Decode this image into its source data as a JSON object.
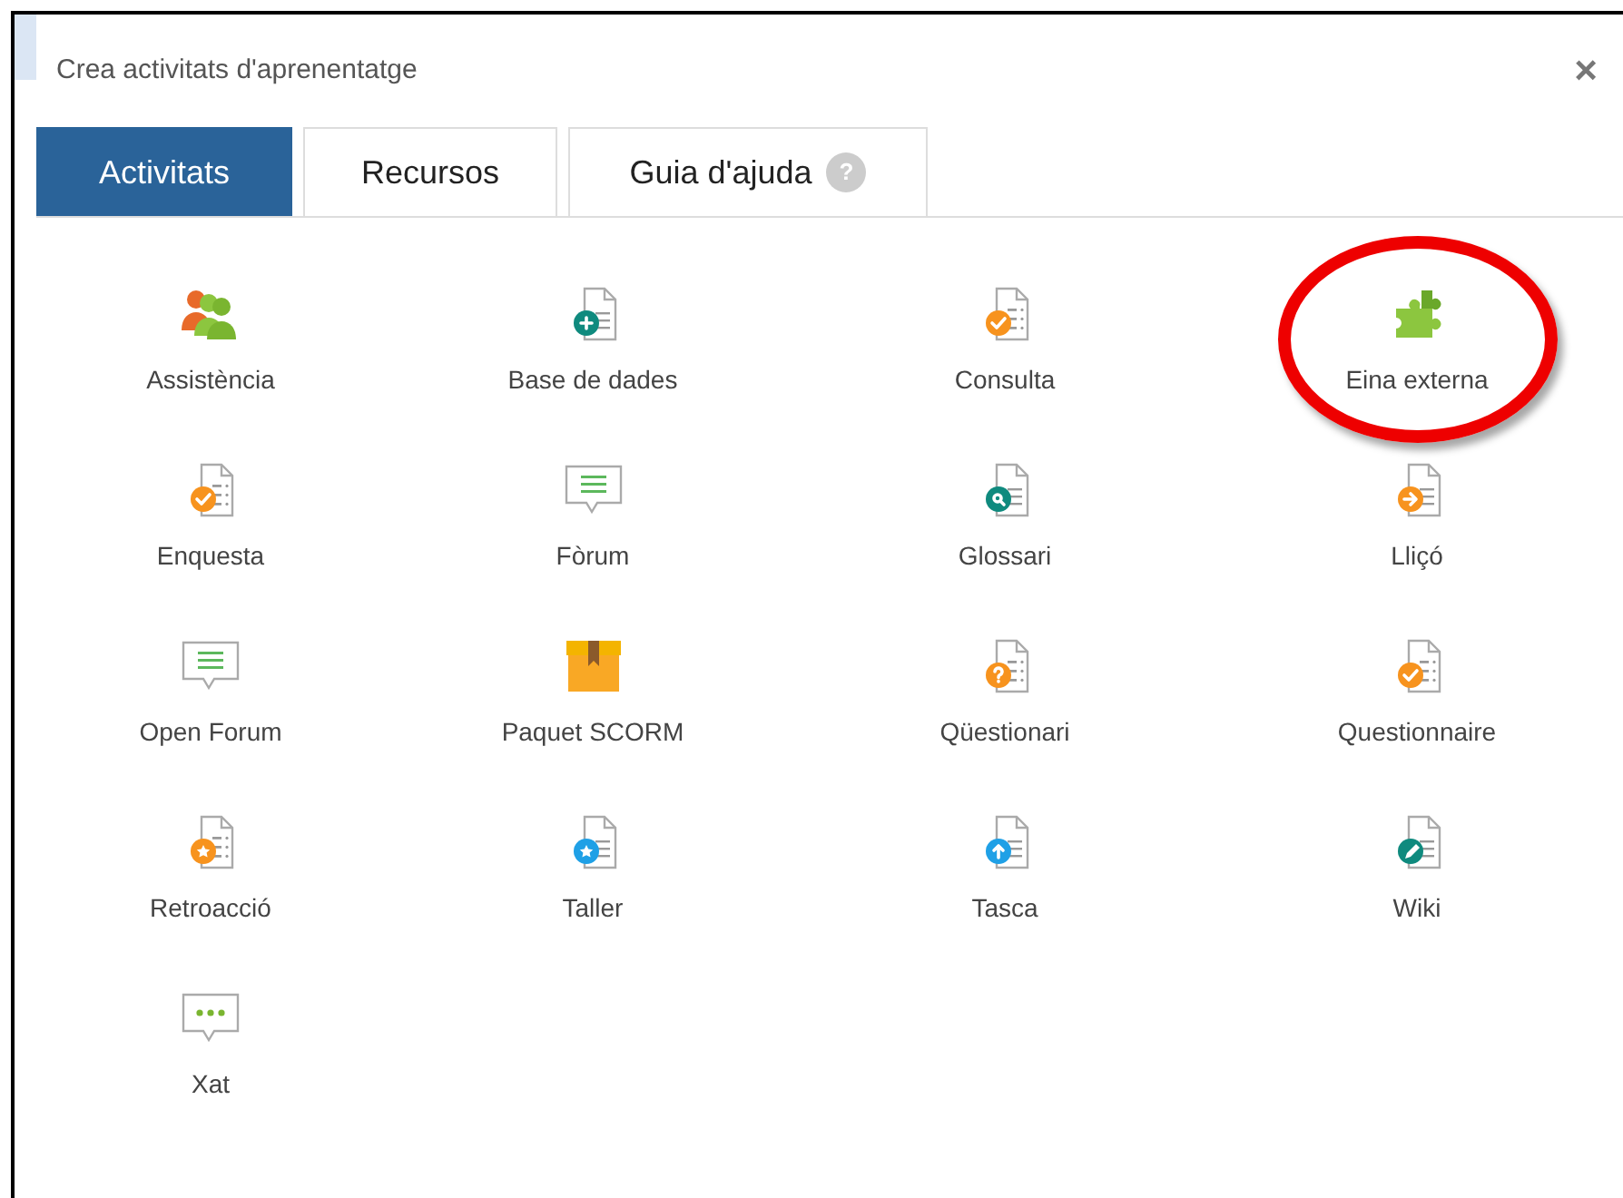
{
  "dialog": {
    "title": "Crea activitats d'aprenentatge",
    "close": "×"
  },
  "tabs": [
    {
      "label": "Activitats",
      "selected": true,
      "help": false
    },
    {
      "label": "Recursos",
      "selected": false,
      "help": false
    },
    {
      "label": "Guia d'ajuda",
      "selected": false,
      "help": true,
      "help_mark": "?"
    }
  ],
  "items": [
    {
      "label": "Assistència",
      "kind": "attendance",
      "highlighted": false
    },
    {
      "label": "Base de dades",
      "kind": "database",
      "highlighted": false
    },
    {
      "label": "Consulta",
      "kind": "choice",
      "highlighted": false
    },
    {
      "label": "Eina externa",
      "kind": "tool",
      "highlighted": true
    },
    {
      "label": "Enquesta",
      "kind": "survey",
      "highlighted": false
    },
    {
      "label": "Fòrum",
      "kind": "forum",
      "highlighted": false
    },
    {
      "label": "Glossari",
      "kind": "glossary",
      "highlighted": false
    },
    {
      "label": "Lliçó",
      "kind": "lesson",
      "highlighted": false
    },
    {
      "label": "Open Forum",
      "kind": "forum",
      "highlighted": false
    },
    {
      "label": "Paquet SCORM",
      "kind": "scorm",
      "highlighted": false
    },
    {
      "label": "Qüestionari",
      "kind": "quiz",
      "highlighted": false
    },
    {
      "label": "Questionnaire",
      "kind": "questionnaire",
      "highlighted": false
    },
    {
      "label": "Retroacció",
      "kind": "feedback",
      "highlighted": false
    },
    {
      "label": "Taller",
      "kind": "workshop",
      "highlighted": false
    },
    {
      "label": "Tasca",
      "kind": "assignment",
      "highlighted": false
    },
    {
      "label": "Wiki",
      "kind": "wiki",
      "highlighted": false
    },
    {
      "label": "Xat",
      "kind": "chat",
      "highlighted": false
    }
  ]
}
